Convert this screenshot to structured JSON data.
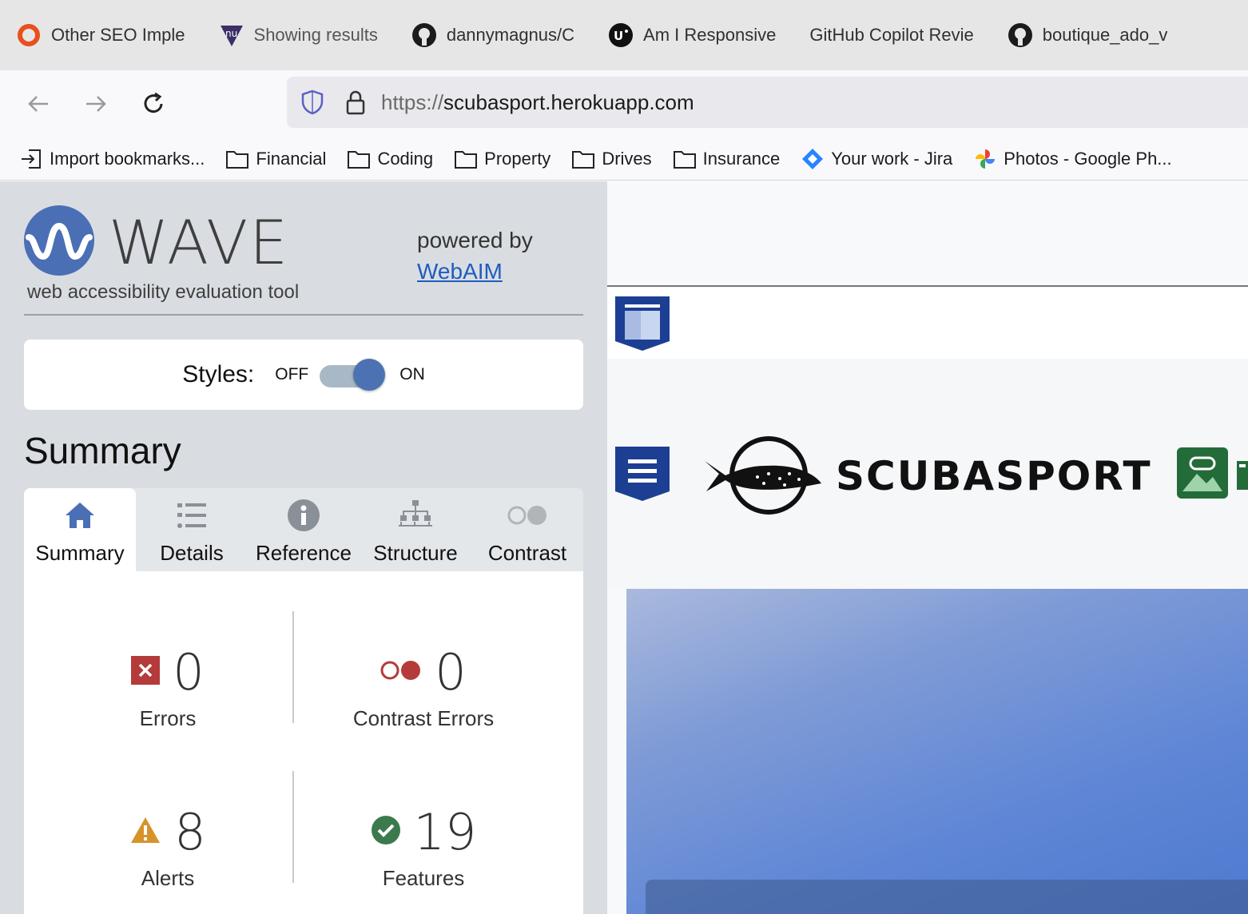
{
  "browser": {
    "tabs": [
      {
        "label": "Other SEO Imple",
        "icon": "seo-ring-icon",
        "color": "#e8501e"
      },
      {
        "label": "Showing results",
        "icon": "nu-validator-icon"
      },
      {
        "label": "dannymagnus/C",
        "icon": "github-icon"
      },
      {
        "label": "Am I Responsive",
        "icon": "ui-icon"
      },
      {
        "label": "GitHub Copilot Revie",
        "icon": ""
      },
      {
        "label": "boutique_ado_v",
        "icon": "github-icon"
      }
    ],
    "url_protocol": "https://",
    "url_host": "scubasport.herokuapp.com",
    "bookmarks": [
      {
        "label": "Import bookmarks...",
        "icon": "import-icon"
      },
      {
        "label": "Financial",
        "icon": "folder-icon"
      },
      {
        "label": "Coding",
        "icon": "folder-icon"
      },
      {
        "label": "Property",
        "icon": "folder-icon"
      },
      {
        "label": "Drives",
        "icon": "folder-icon"
      },
      {
        "label": "Insurance",
        "icon": "folder-icon"
      },
      {
        "label": "Your work - Jira",
        "icon": "jira-icon"
      },
      {
        "label": "Photos - Google Ph...",
        "icon": "google-photos-icon"
      }
    ]
  },
  "wave": {
    "title": "WAVE",
    "subtitle": "web accessibility evaluation tool",
    "powered_by": "powered by",
    "webaim_link": "WebAIM",
    "styles_label": "Styles:",
    "styles_off": "OFF",
    "styles_on": "ON",
    "summary_heading": "Summary",
    "tabs": [
      {
        "label": "Summary",
        "icon": "home-icon"
      },
      {
        "label": "Details",
        "icon": "list-icon"
      },
      {
        "label": "Reference",
        "icon": "info-icon"
      },
      {
        "label": "Structure",
        "icon": "hierarchy-icon"
      },
      {
        "label": "Contrast",
        "icon": "contrast-icon"
      }
    ],
    "stats": {
      "errors": {
        "value": "0",
        "label": "Errors",
        "color": "#b53a3a"
      },
      "contrast_errors": {
        "value": "0",
        "label": "Contrast Errors",
        "color": "#b53a3a"
      },
      "alerts": {
        "value": "8",
        "label": "Alerts",
        "color": "#d8922a"
      },
      "features": {
        "value": "19",
        "label": "Features",
        "color": "#3c7a4d"
      }
    }
  },
  "page": {
    "brand": "SCUBASPORT"
  }
}
